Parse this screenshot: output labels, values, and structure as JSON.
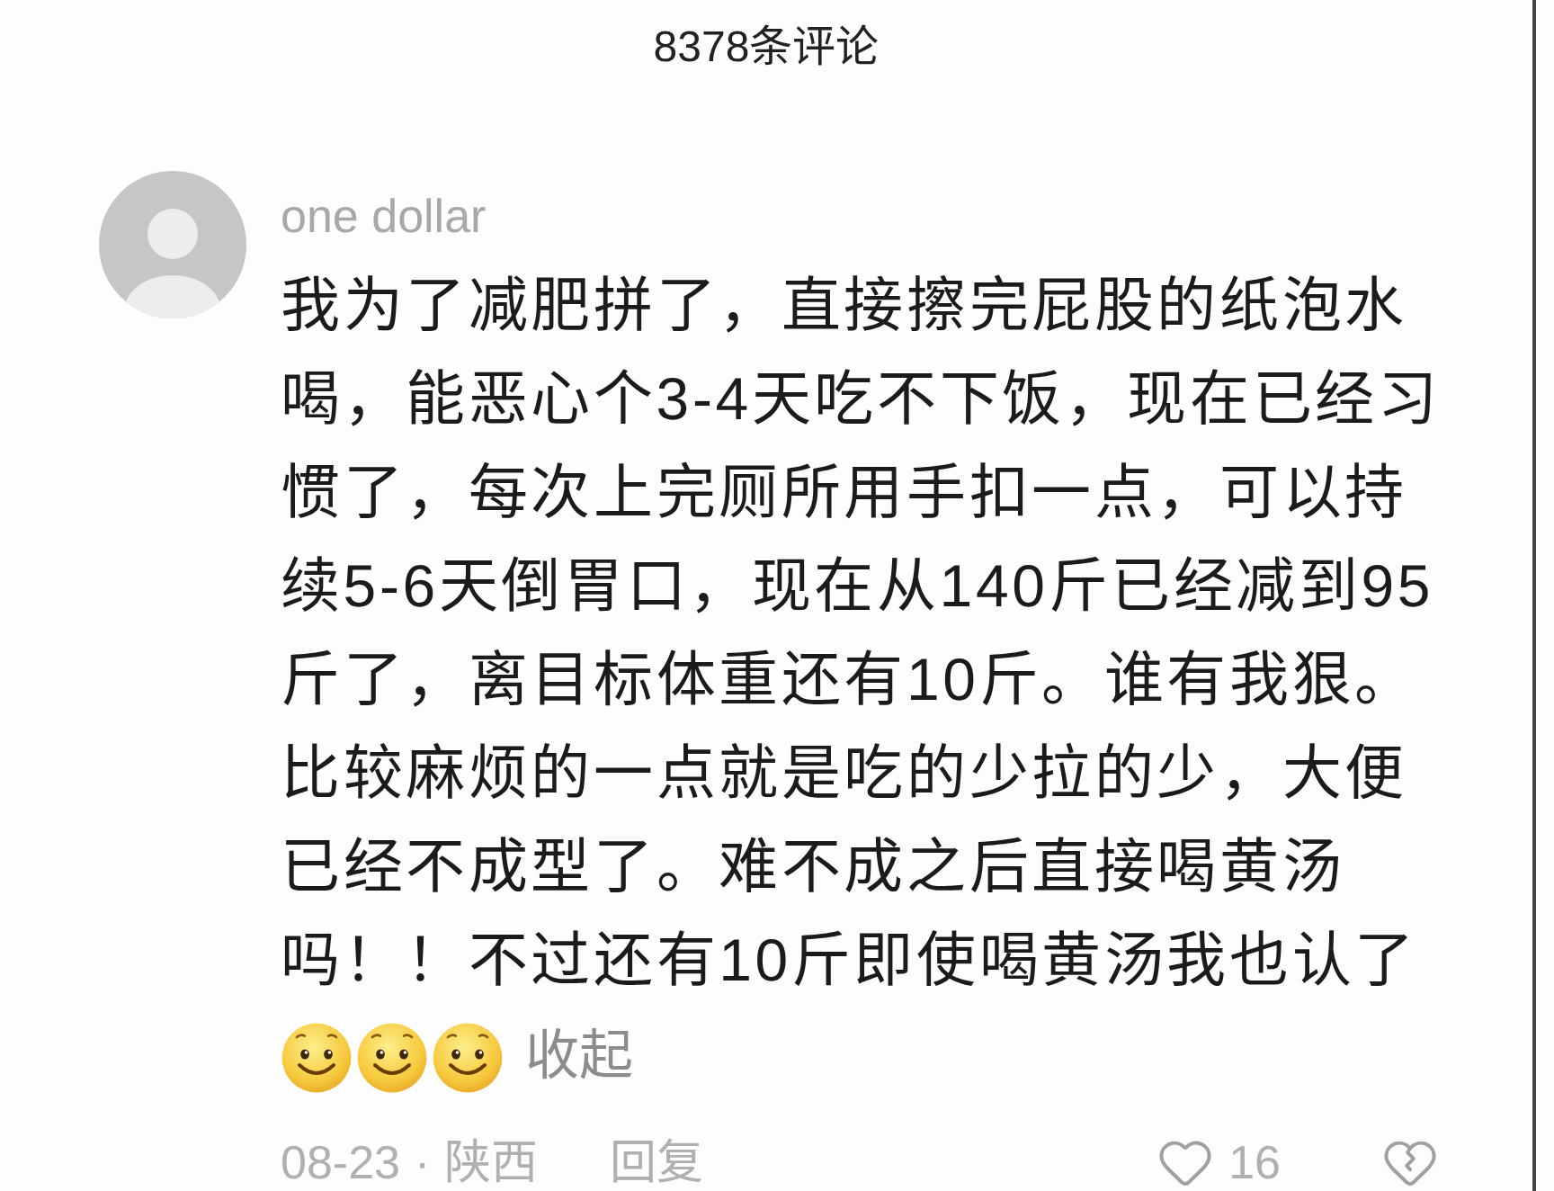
{
  "header": {
    "title": "8378条评论"
  },
  "comment": {
    "author": "one dollar",
    "text": "我为了减肥拼了，直接擦完屁股的纸泡水喝，能恶心个3-4天吃不下饭，现在已经习惯了，每次上完厕所用手扣一点，可以持续5-6天倒胃口，现在从140斤已经减到95斤了，离目标体重还有10斤。谁有我狠。比较麻烦的一点就是吃的少拉的少，大便已经不成型了。难不成之后直接喝黄汤吗！！不过还有10斤即使喝黄汤我也认了",
    "emojis": [
      {
        "kind": "smile"
      },
      {
        "kind": "smile"
      },
      {
        "kind": "smile"
      }
    ],
    "collapse_link": "收起",
    "date": "08-23",
    "separator": "·",
    "location": "陕西",
    "reply_button": "回复",
    "like_count": "16",
    "liked": false
  }
}
